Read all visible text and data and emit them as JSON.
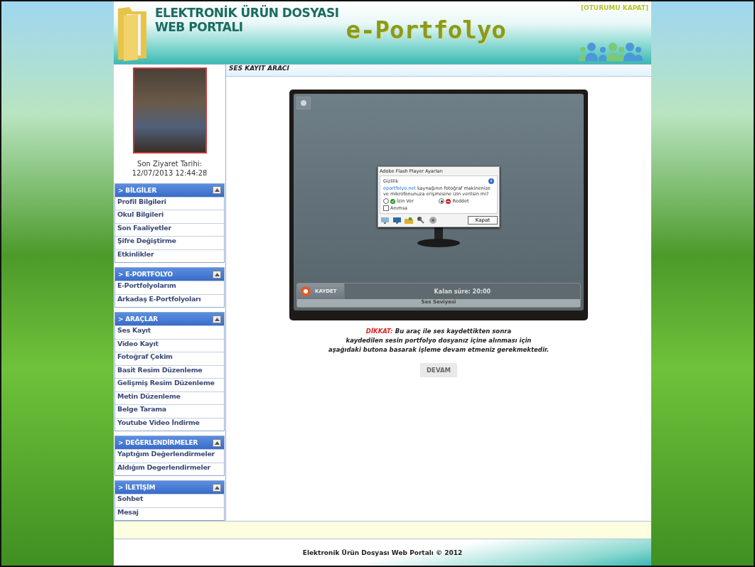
{
  "header": {
    "title_lines": [
      "ELEKTRONİK ÜRÜN DOSYASI",
      "WEB PORTALI"
    ],
    "logo_text": "e-Portfolyo",
    "logout": "[OTURUMU KAPAT]"
  },
  "profile": {
    "last_visit_label": "Son Ziyaret Tarihi:",
    "last_visit": "12/07/2013 12:44:28"
  },
  "sidebar": {
    "sections": [
      {
        "title": "> BİLGİLER",
        "expanded": true,
        "items": [
          "Profil Bilgileri",
          "Okul Bilgileri",
          "Son Faaliyetler",
          "Şifre Değiştirme",
          "Etkinlikler"
        ]
      },
      {
        "title": "> E-PORTFOLYO",
        "expanded": true,
        "items": [
          "E-Portfolyolarım",
          "Arkadaş E-Portfolyoları"
        ]
      },
      {
        "title": "> ARAÇLAR",
        "expanded": true,
        "items": [
          "Ses Kayıt",
          "Video Kayıt",
          "Fotoğraf Çekim",
          "Basit Resim Düzenleme",
          "Gelişmiş Resim Düzenleme",
          "Metin Düzenleme",
          "Belge Tarama",
          "Youtube Video İndirme"
        ]
      },
      {
        "title": "> DEĞERLENDİRMELER",
        "expanded": true,
        "items": [
          "Yaptığım Değerlendirmeler",
          "Aldığım Degerlendirmeler"
        ]
      },
      {
        "title": "> İLETİŞİM",
        "expanded": true,
        "items": [
          "Sohbet",
          "Mesaj"
        ]
      }
    ]
  },
  "content": {
    "title": "SES KAYIT ARACI",
    "flash_dialog": {
      "title": "Adobe Flash Player Ayarları",
      "section": "Gizlilik",
      "link": "eportfolyo.net",
      "message": "kaynağının fotoğraf makinenize ve mikrofonunuza erişmesine izin verilsin mi?",
      "options": [
        {
          "label": "İzin Ver",
          "selected": false
        },
        {
          "label": "Reddet",
          "selected": true
        }
      ],
      "remember": {
        "label": "Anımsa",
        "checked": false
      },
      "close_button": "Kapat"
    },
    "recorder": {
      "record_button": "KAYDET",
      "remaining": "Kalan süre: 20:00",
      "level_label": "Ses Seviyesi"
    },
    "warning": {
      "label": "DİKKAT:",
      "lines": [
        "Bu araç ile ses kaydettikten sonra",
        "kaydedilen sesin portfolyo dosyanız içine alınması için",
        "aşağıdaki butona basarak işleme devam etmeniz gerekmektedir."
      ]
    },
    "continue_button": "DEVAM"
  },
  "footer": "Elektronik Ürün Dosyası Web Portalı © 2012"
}
